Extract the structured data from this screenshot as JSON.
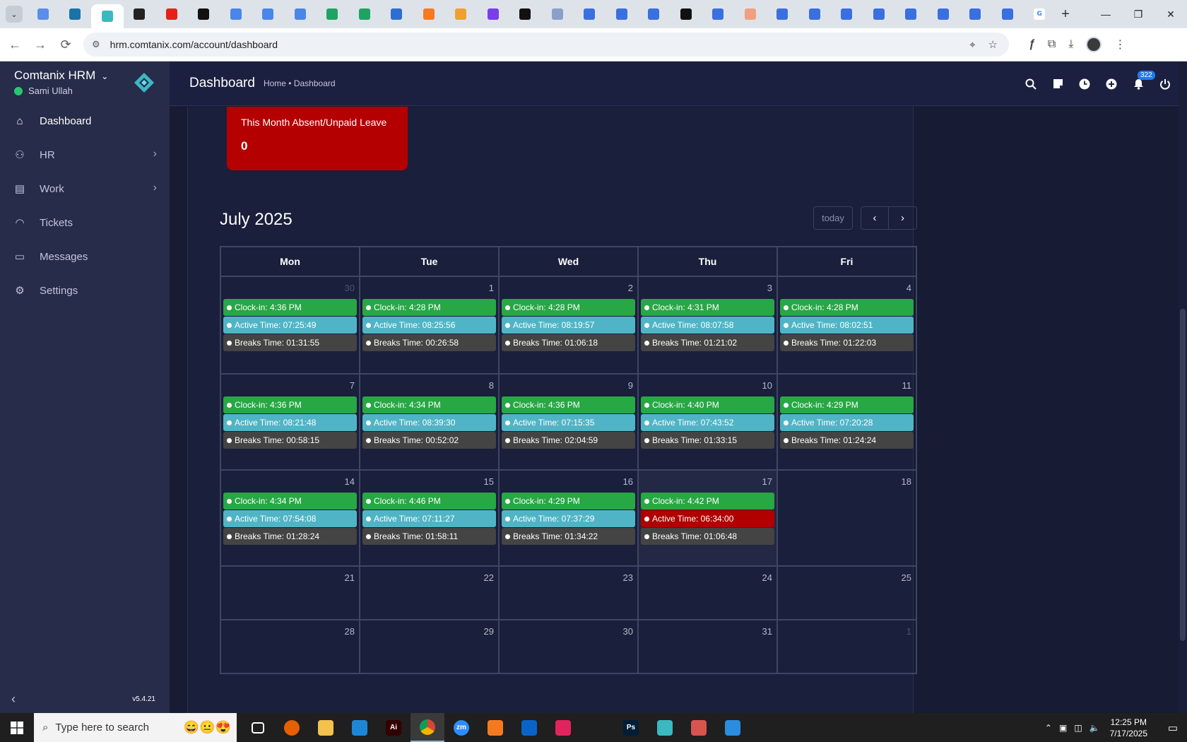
{
  "browser": {
    "tabs": [
      {
        "icon": "chrome-logo",
        "color": "#5a8ee8",
        "glyph": ""
      },
      {
        "icon": "vpn-logo",
        "color": "#1a73a8",
        "glyph": ""
      },
      {
        "icon": "comtanix-logo",
        "color": "#3cb8c0",
        "glyph": "",
        "active": true
      },
      {
        "icon": "openai-logo",
        "color": "#222222",
        "glyph": ""
      },
      {
        "icon": "youtube-logo",
        "color": "#e62117",
        "glyph": ""
      },
      {
        "icon": "bolt-logo",
        "color": "#111111",
        "glyph": ""
      },
      {
        "icon": "docs-logo",
        "color": "#4a86e8",
        "glyph": ""
      },
      {
        "icon": "docs-logo",
        "color": "#4a86e8",
        "glyph": ""
      },
      {
        "icon": "docs-logo",
        "color": "#4a86e8",
        "glyph": ""
      },
      {
        "icon": "sheets-logo",
        "color": "#1ea362",
        "glyph": ""
      },
      {
        "icon": "sheets-logo",
        "color": "#1ea362",
        "glyph": ""
      },
      {
        "icon": "bootstrap-logo",
        "color": "#2c6fd1",
        "glyph": ""
      },
      {
        "icon": "xampp-logo",
        "color": "#f57a1f",
        "glyph": ""
      },
      {
        "icon": "vue-logo",
        "color": "#f0a030",
        "glyph": ""
      },
      {
        "icon": "code-logo",
        "color": "#7a3ee8",
        "glyph": ""
      },
      {
        "icon": "laravel-logo",
        "color": "#111111",
        "glyph": ""
      },
      {
        "icon": "grid-logo",
        "color": "#8aa0c8",
        "glyph": ""
      },
      {
        "icon": "forms-logo",
        "color": "#3a6fe0",
        "glyph": ""
      },
      {
        "icon": "forms-logo",
        "color": "#3a6fe0",
        "glyph": ""
      },
      {
        "icon": "forms-logo",
        "color": "#3a6fe0",
        "glyph": ""
      },
      {
        "icon": "medium-logo",
        "color": "#111111",
        "glyph": ""
      },
      {
        "icon": "forms-logo",
        "color": "#3a6fe0",
        "glyph": ""
      },
      {
        "icon": "app-logo",
        "color": "#f0a080",
        "glyph": ""
      },
      {
        "icon": "forms-logo",
        "color": "#3a6fe0",
        "glyph": ""
      },
      {
        "icon": "forms-logo",
        "color": "#3a6fe0",
        "glyph": ""
      },
      {
        "icon": "forms-logo",
        "color": "#3a6fe0",
        "glyph": ""
      },
      {
        "icon": "forms-logo",
        "color": "#3a6fe0",
        "glyph": ""
      },
      {
        "icon": "forms-logo",
        "color": "#3a6fe0",
        "glyph": ""
      },
      {
        "icon": "forms-logo",
        "color": "#3a6fe0",
        "glyph": ""
      },
      {
        "icon": "forms-logo",
        "color": "#3a6fe0",
        "glyph": ""
      },
      {
        "icon": "forms-logo",
        "color": "#3a6fe0",
        "glyph": ""
      },
      {
        "icon": "google-logo",
        "color": "#ffffff",
        "glyph": "G"
      }
    ],
    "url": "hrm.comtanix.com/account/dashboard"
  },
  "sidebar": {
    "brand": "Comtanix HRM",
    "user": "Sami Ullah",
    "items": [
      {
        "label": "Dashboard",
        "icon": "home-icon",
        "active": true,
        "arrow": false
      },
      {
        "label": "HR",
        "icon": "users-icon",
        "active": false,
        "arrow": true
      },
      {
        "label": "Work",
        "icon": "briefcase-icon",
        "active": false,
        "arrow": true
      },
      {
        "label": "Tickets",
        "icon": "headset-icon",
        "active": false,
        "arrow": false
      },
      {
        "label": "Messages",
        "icon": "message-icon",
        "active": false,
        "arrow": false
      },
      {
        "label": "Settings",
        "icon": "gear-icon",
        "active": false,
        "arrow": false
      }
    ],
    "version": "v5.4.21"
  },
  "header": {
    "title": "Dashboard",
    "breadcrumb": "Home • Dashboard",
    "notification_count": "322"
  },
  "card": {
    "title": "This Month Absent/Unpaid Leave",
    "value": "0"
  },
  "calendar": {
    "title": "July 2025",
    "today_label": "today",
    "days": [
      "Mon",
      "Tue",
      "Wed",
      "Thu",
      "Fri"
    ],
    "weeks": [
      [
        {
          "date": "30",
          "muted": true,
          "events": [
            [
              "green",
              "Clock-in: 4:36 PM"
            ],
            [
              "cyan",
              "Active Time: 07:25:49"
            ],
            [
              "dark",
              "Breaks Time: 01:31:55"
            ]
          ]
        },
        {
          "date": "1",
          "events": [
            [
              "green",
              "Clock-in: 4:28 PM"
            ],
            [
              "cyan",
              "Active Time: 08:25:56"
            ],
            [
              "dark",
              "Breaks Time: 00:26:58"
            ]
          ]
        },
        {
          "date": "2",
          "events": [
            [
              "green",
              "Clock-in: 4:28 PM"
            ],
            [
              "cyan",
              "Active Time: 08:19:57"
            ],
            [
              "dark",
              "Breaks Time: 01:06:18"
            ]
          ]
        },
        {
          "date": "3",
          "events": [
            [
              "green",
              "Clock-in: 4:31 PM"
            ],
            [
              "cyan",
              "Active Time: 08:07:58"
            ],
            [
              "dark",
              "Breaks Time: 01:21:02"
            ]
          ]
        },
        {
          "date": "4",
          "events": [
            [
              "green",
              "Clock-in: 4:28 PM"
            ],
            [
              "cyan",
              "Active Time: 08:02:51"
            ],
            [
              "dark",
              "Breaks Time: 01:22:03"
            ]
          ]
        }
      ],
      [
        {
          "date": "7",
          "events": [
            [
              "green",
              "Clock-in: 4:36 PM"
            ],
            [
              "cyan",
              "Active Time: 08:21:48"
            ],
            [
              "dark",
              "Breaks Time: 00:58:15"
            ]
          ]
        },
        {
          "date": "8",
          "events": [
            [
              "green",
              "Clock-in: 4:34 PM"
            ],
            [
              "cyan",
              "Active Time: 08:39:30"
            ],
            [
              "dark",
              "Breaks Time: 00:52:02"
            ]
          ]
        },
        {
          "date": "9",
          "events": [
            [
              "green",
              "Clock-in: 4:36 PM"
            ],
            [
              "cyan",
              "Active Time: 07:15:35"
            ],
            [
              "dark",
              "Breaks Time: 02:04:59"
            ]
          ]
        },
        {
          "date": "10",
          "events": [
            [
              "green",
              "Clock-in: 4:40 PM"
            ],
            [
              "cyan",
              "Active Time: 07:43:52"
            ],
            [
              "dark",
              "Breaks Time: 01:33:15"
            ]
          ]
        },
        {
          "date": "11",
          "events": [
            [
              "green",
              "Clock-in: 4:29 PM"
            ],
            [
              "cyan",
              "Active Time: 07:20:28"
            ],
            [
              "dark",
              "Breaks Time: 01:24:24"
            ]
          ]
        }
      ],
      [
        {
          "date": "14",
          "events": [
            [
              "green",
              "Clock-in: 4:34 PM"
            ],
            [
              "cyan",
              "Active Time: 07:54:08"
            ],
            [
              "dark",
              "Breaks Time: 01:28:24"
            ]
          ]
        },
        {
          "date": "15",
          "events": [
            [
              "green",
              "Clock-in: 4:46 PM"
            ],
            [
              "cyan",
              "Active Time: 07:11:27"
            ],
            [
              "dark",
              "Breaks Time: 01:58:11"
            ]
          ]
        },
        {
          "date": "16",
          "events": [
            [
              "green",
              "Clock-in: 4:29 PM"
            ],
            [
              "cyan",
              "Active Time: 07:37:29"
            ],
            [
              "dark",
              "Breaks Time: 01:34:22"
            ]
          ]
        },
        {
          "date": "17",
          "today": true,
          "events": [
            [
              "green",
              "Clock-in: 4:42 PM"
            ],
            [
              "red",
              "Active Time: 06:34:00"
            ],
            [
              "dark",
              "Breaks Time: 01:06:48"
            ]
          ]
        },
        {
          "date": "18",
          "events": []
        }
      ],
      [
        {
          "date": "21",
          "events": []
        },
        {
          "date": "22",
          "events": []
        },
        {
          "date": "23",
          "events": []
        },
        {
          "date": "24",
          "events": []
        },
        {
          "date": "25",
          "events": []
        }
      ],
      [
        {
          "date": "28",
          "events": []
        },
        {
          "date": "29",
          "events": []
        },
        {
          "date": "30",
          "events": []
        },
        {
          "date": "31",
          "events": []
        },
        {
          "date": "1",
          "muted": true,
          "events": []
        }
      ]
    ]
  },
  "taskbar": {
    "search_placeholder": "Type here to search",
    "apps": [
      {
        "icon": "task-view-icon",
        "color": "#1f1f1f",
        "glyph": "",
        "active": false
      },
      {
        "icon": "firefox-icon",
        "color": "#e66000",
        "glyph": "",
        "active": false
      },
      {
        "icon": "file-explorer-icon",
        "color": "#f2c14e",
        "glyph": "",
        "active": false
      },
      {
        "icon": "vscode-icon",
        "color": "#1f86d6",
        "glyph": "",
        "active": false
      },
      {
        "icon": "illustrator-icon",
        "color": "#330000",
        "glyph": "Ai",
        "active": false
      },
      {
        "icon": "chrome-icon",
        "color": "#4285f4",
        "glyph": "",
        "active": true
      },
      {
        "icon": "zoom-icon",
        "color": "#2d8cff",
        "glyph": "zm",
        "active": false
      },
      {
        "icon": "xampp-icon",
        "color": "#f57a1f",
        "glyph": "",
        "active": false
      },
      {
        "icon": "outlook-icon",
        "color": "#0a64c8",
        "glyph": "",
        "active": false
      },
      {
        "icon": "creative-cloud-icon",
        "color": "#e0245e",
        "glyph": "",
        "active": false
      },
      {
        "icon": "pen-tool-icon",
        "color": "#1f1f1f",
        "glyph": "",
        "active": false
      },
      {
        "icon": "photoshop-icon",
        "color": "#001e36",
        "glyph": "Ps",
        "active": false
      },
      {
        "icon": "comtanix-icon",
        "color": "#3cb8c0",
        "glyph": "",
        "active": false
      },
      {
        "icon": "snipping-tool-icon",
        "color": "#d9534f",
        "glyph": "",
        "active": false
      },
      {
        "icon": "photos-icon",
        "color": "#2a8de0",
        "glyph": "",
        "active": false
      }
    ],
    "time": "12:25 PM",
    "date": "7/17/2025"
  }
}
